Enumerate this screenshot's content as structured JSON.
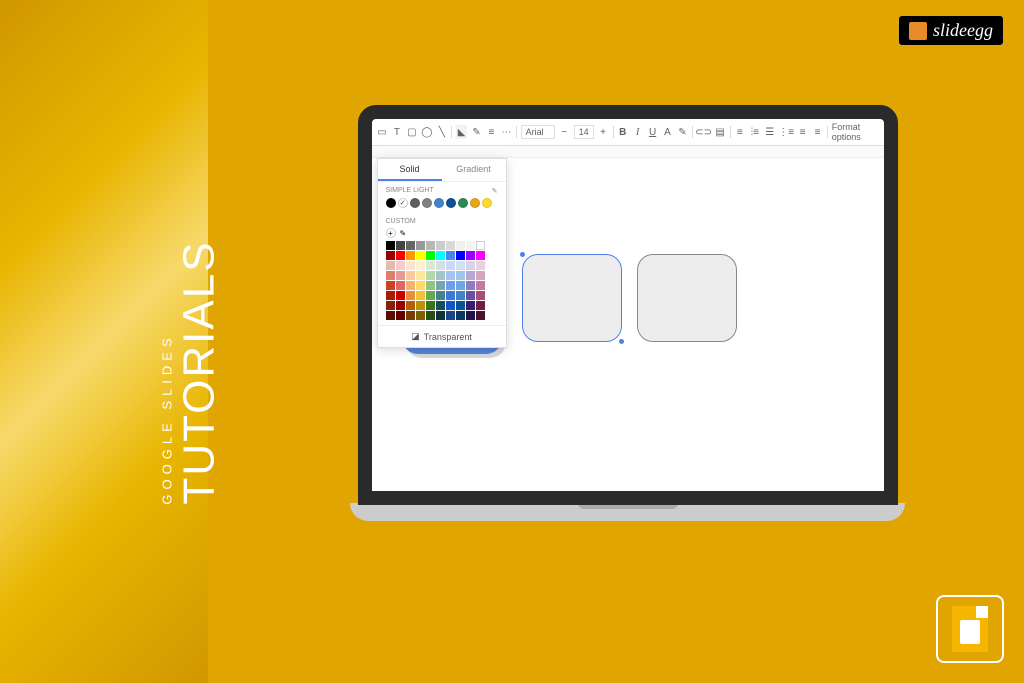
{
  "sidebar": {
    "subtitle": "GOOGLE SLIDES",
    "title": "TUTORIALS"
  },
  "brand": {
    "name": "slideegg"
  },
  "toolbar": {
    "font": "Arial",
    "font_size": "14",
    "format_options": "Format options"
  },
  "color_picker": {
    "tab_solid": "Solid",
    "tab_gradient": "Gradient",
    "section_theme": "SIMPLE LIGHT",
    "section_custom": "CUSTOM",
    "transparent": "Transparent",
    "theme_colors": [
      "#000000",
      "#ffffff",
      "#5f5f5f",
      "#808080",
      "#3d85c6",
      "#0b5394",
      "#2a8a56",
      "#e6a817",
      "#ffda33"
    ],
    "palette": [
      "#000000",
      "#434343",
      "#666666",
      "#999999",
      "#b7b7b7",
      "#cccccc",
      "#d9d9d9",
      "#efefef",
      "#f3f3f3",
      "#ffffff",
      "#980000",
      "#ff0000",
      "#ff9900",
      "#ffff00",
      "#00ff00",
      "#00ffff",
      "#4a86e8",
      "#0000ff",
      "#9900ff",
      "#ff00ff",
      "#e6b8af",
      "#f4cccc",
      "#fce5cd",
      "#fff2cc",
      "#d9ead3",
      "#d0e0e3",
      "#c9daf8",
      "#cfe2f3",
      "#d9d2e9",
      "#ead1dc",
      "#dd7e6b",
      "#ea9999",
      "#f9cb9c",
      "#ffe599",
      "#b6d7a8",
      "#a2c4c9",
      "#a4c2f4",
      "#9fc5e8",
      "#b4a7d6",
      "#d5a6bd",
      "#cc4125",
      "#e06666",
      "#f6b26b",
      "#ffd966",
      "#93c47d",
      "#76a5af",
      "#6d9eeb",
      "#6fa8dc",
      "#8e7cc3",
      "#c27ba0",
      "#a61c00",
      "#cc0000",
      "#e69138",
      "#f1c232",
      "#6aa84f",
      "#45818e",
      "#3c78d8",
      "#3d85c6",
      "#674ea7",
      "#a64d79",
      "#85200c",
      "#990000",
      "#b45f06",
      "#bf9000",
      "#38761d",
      "#134f5c",
      "#1155cc",
      "#0b5394",
      "#351c75",
      "#741b47",
      "#5b0f00",
      "#660000",
      "#783f04",
      "#7f6000",
      "#274e13",
      "#0c343d",
      "#1c4587",
      "#073763",
      "#20124d",
      "#4c1130"
    ]
  }
}
